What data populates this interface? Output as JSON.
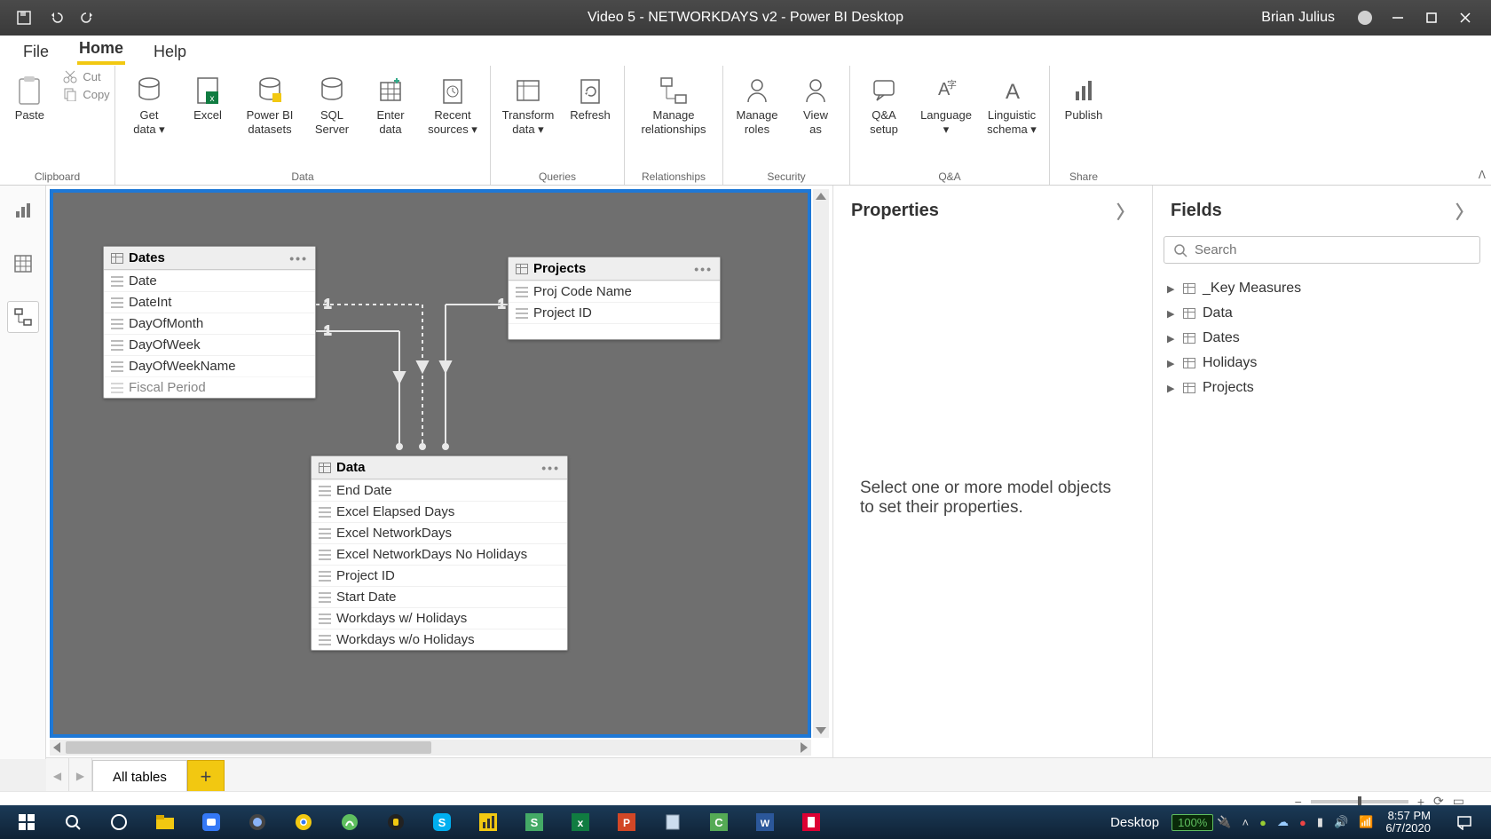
{
  "titlebar": {
    "title": "Video 5 - NETWORKDAYS v2 - Power BI Desktop",
    "user": "Brian Julius"
  },
  "menu": {
    "file": "File",
    "home": "Home",
    "help": "Help"
  },
  "ribbon": {
    "clipboard": {
      "label": "Clipboard",
      "paste": "Paste",
      "cut": "Cut",
      "copy": "Copy"
    },
    "data": {
      "label": "Data",
      "getdata": "Get\ndata ▾",
      "excel": "Excel",
      "pbids": "Power BI\ndatasets",
      "sql": "SQL\nServer",
      "enter": "Enter\ndata",
      "recent": "Recent\nsources ▾"
    },
    "queries": {
      "label": "Queries",
      "transform": "Transform\ndata ▾",
      "refresh": "Refresh"
    },
    "relationships": {
      "label": "Relationships",
      "manage": "Manage\nrelationships"
    },
    "security": {
      "label": "Security",
      "roles": "Manage\nroles",
      "viewas": "View\nas"
    },
    "qa": {
      "label": "Q&A",
      "setup": "Q&A\nsetup",
      "language": "Language\n▾",
      "schema": "Linguistic\nschema ▾"
    },
    "share": {
      "label": "Share",
      "publish": "Publish"
    }
  },
  "canvas": {
    "tables": {
      "dates": {
        "name": "Dates",
        "cols": [
          "Date",
          "DateInt",
          "DayOfMonth",
          "DayOfWeek",
          "DayOfWeekName",
          "Fiscal Period"
        ]
      },
      "projects": {
        "name": "Projects",
        "cols": [
          "Proj Code Name",
          "Project ID"
        ]
      },
      "data": {
        "name": "Data",
        "cols": [
          "End Date",
          "Excel Elapsed Days",
          "Excel NetworkDays",
          "Excel NetworkDays No Holidays",
          "Project ID",
          "Start Date",
          "Workdays w/ Holidays",
          "Workdays w/o Holidays"
        ]
      }
    },
    "rel_labels": {
      "one_a": "1",
      "one_b": "1",
      "one_c": "1"
    }
  },
  "properties": {
    "title": "Properties",
    "empty": "Select one or more model objects to set their properties."
  },
  "fields": {
    "title": "Fields",
    "search_placeholder": "Search",
    "tables": [
      "_Key Measures",
      "Data",
      "Dates",
      "Holidays",
      "Projects"
    ]
  },
  "pagetabs": {
    "all": "All tables"
  },
  "taskbar": {
    "desktop": "Desktop",
    "battery": "100%",
    "time": "8:57 PM",
    "date": "6/7/2020"
  }
}
